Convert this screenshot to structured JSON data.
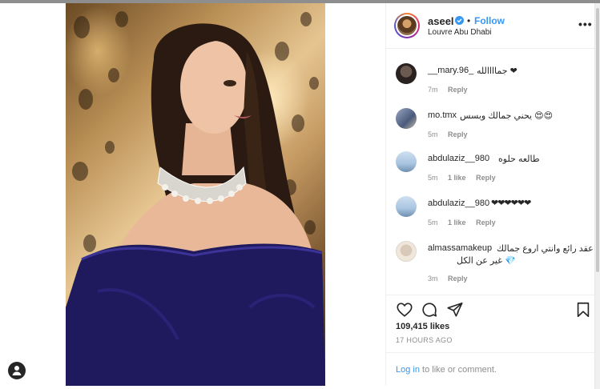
{
  "post": {
    "username": "aseel",
    "follow_label": "Follow",
    "separator": "•",
    "location": "Louvre Abu Dhabi",
    "more_label": "•••"
  },
  "comments": [
    {
      "user": "__mary.96_",
      "text": "جماااالله ❤",
      "time": "7m",
      "likes": "",
      "reply": "Reply"
    },
    {
      "user": "mo.tmx",
      "text": "يحني جمالك وبسس 😍😍",
      "time": "5m",
      "likes": "",
      "reply": "Reply"
    },
    {
      "user": "abdulaziz__980",
      "text": "طالعه حلوه",
      "time": "5m",
      "likes": "1 like",
      "reply": "Reply"
    },
    {
      "user": "abdulaziz__980",
      "text": "❤❤❤❤❤❤",
      "time": "5m",
      "likes": "1 like",
      "reply": "Reply"
    },
    {
      "user": "almassamakeup",
      "text": "عقد رائع وانتي اروع جمالك",
      "text2": "غير عن الكل 💎",
      "time": "3m",
      "likes": "",
      "reply": "Reply"
    }
  ],
  "actions": {
    "like_icon": "heart-icon",
    "comment_icon": "comment-icon",
    "share_icon": "share-icon",
    "save_icon": "bookmark-icon"
  },
  "likes_text": "109,415 likes",
  "timestamp": "17 HOURS AGO",
  "login": {
    "link_text": "Log in",
    "rest_text": " to like or comment."
  },
  "colors": {
    "link_blue": "#3897f0",
    "meta_gray": "#8e8e8e",
    "text_dark": "#262626",
    "dress_purple": "#1f1a5e"
  }
}
